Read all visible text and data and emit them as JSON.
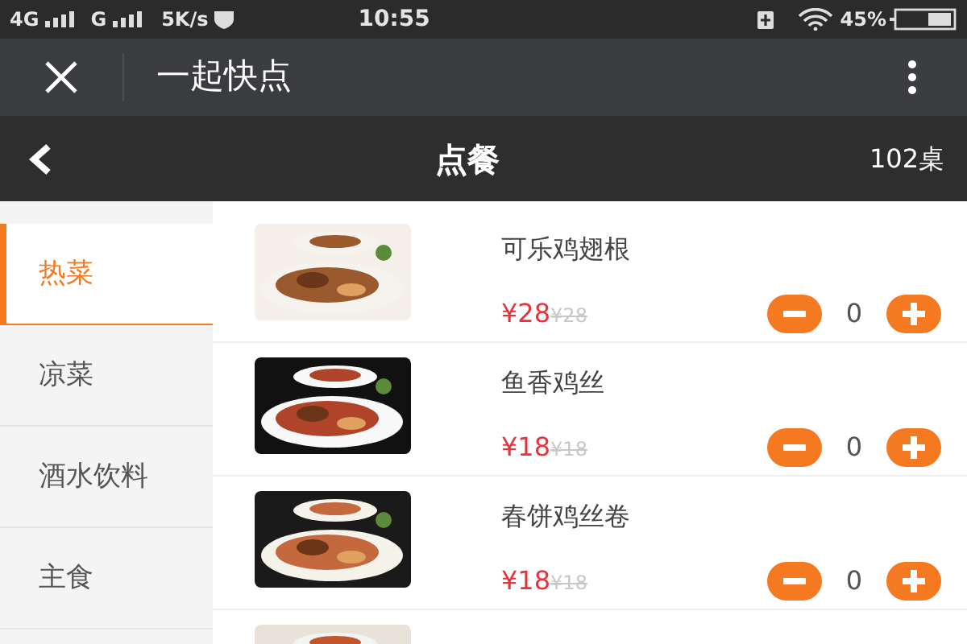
{
  "status_bar": {
    "network_1": "4G",
    "network_2": "G",
    "speed": "5K/s",
    "time": "10:55",
    "battery": "45%"
  },
  "app_bar": {
    "title": "一起快点"
  },
  "header": {
    "title": "点餐",
    "table": "102桌"
  },
  "categories": [
    {
      "label": "热菜",
      "selected": true
    },
    {
      "label": "凉菜",
      "selected": false
    },
    {
      "label": "酒水饮料",
      "selected": false
    },
    {
      "label": "主食",
      "selected": false
    }
  ],
  "dishes": [
    {
      "name": "可乐鸡翅根",
      "price": "¥28",
      "original_price": "¥28",
      "quantity": "0",
      "kind": "picture"
    },
    {
      "name": "鱼香鸡丝",
      "price": "¥18",
      "original_price": "¥18",
      "quantity": "0",
      "kind": "picture"
    },
    {
      "name": "春饼鸡丝卷",
      "price": "¥18",
      "original_price": "¥18",
      "quantity": "0",
      "kind": "picture"
    },
    {
      "kind": "picture"
    }
  ]
}
